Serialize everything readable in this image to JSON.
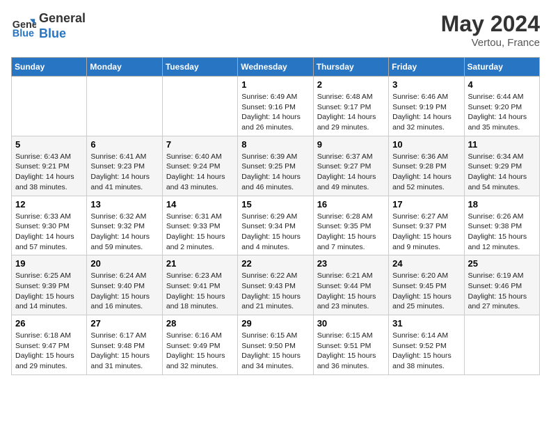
{
  "header": {
    "logo_line1": "General",
    "logo_line2": "Blue",
    "month_year": "May 2024",
    "location": "Vertou, France"
  },
  "weekdays": [
    "Sunday",
    "Monday",
    "Tuesday",
    "Wednesday",
    "Thursday",
    "Friday",
    "Saturday"
  ],
  "weeks": [
    [
      {
        "day": "",
        "info": ""
      },
      {
        "day": "",
        "info": ""
      },
      {
        "day": "",
        "info": ""
      },
      {
        "day": "1",
        "info": "Sunrise: 6:49 AM\nSunset: 9:16 PM\nDaylight: 14 hours and 26 minutes."
      },
      {
        "day": "2",
        "info": "Sunrise: 6:48 AM\nSunset: 9:17 PM\nDaylight: 14 hours and 29 minutes."
      },
      {
        "day": "3",
        "info": "Sunrise: 6:46 AM\nSunset: 9:19 PM\nDaylight: 14 hours and 32 minutes."
      },
      {
        "day": "4",
        "info": "Sunrise: 6:44 AM\nSunset: 9:20 PM\nDaylight: 14 hours and 35 minutes."
      }
    ],
    [
      {
        "day": "5",
        "info": "Sunrise: 6:43 AM\nSunset: 9:21 PM\nDaylight: 14 hours and 38 minutes."
      },
      {
        "day": "6",
        "info": "Sunrise: 6:41 AM\nSunset: 9:23 PM\nDaylight: 14 hours and 41 minutes."
      },
      {
        "day": "7",
        "info": "Sunrise: 6:40 AM\nSunset: 9:24 PM\nDaylight: 14 hours and 43 minutes."
      },
      {
        "day": "8",
        "info": "Sunrise: 6:39 AM\nSunset: 9:25 PM\nDaylight: 14 hours and 46 minutes."
      },
      {
        "day": "9",
        "info": "Sunrise: 6:37 AM\nSunset: 9:27 PM\nDaylight: 14 hours and 49 minutes."
      },
      {
        "day": "10",
        "info": "Sunrise: 6:36 AM\nSunset: 9:28 PM\nDaylight: 14 hours and 52 minutes."
      },
      {
        "day": "11",
        "info": "Sunrise: 6:34 AM\nSunset: 9:29 PM\nDaylight: 14 hours and 54 minutes."
      }
    ],
    [
      {
        "day": "12",
        "info": "Sunrise: 6:33 AM\nSunset: 9:30 PM\nDaylight: 14 hours and 57 minutes."
      },
      {
        "day": "13",
        "info": "Sunrise: 6:32 AM\nSunset: 9:32 PM\nDaylight: 14 hours and 59 minutes."
      },
      {
        "day": "14",
        "info": "Sunrise: 6:31 AM\nSunset: 9:33 PM\nDaylight: 15 hours and 2 minutes."
      },
      {
        "day": "15",
        "info": "Sunrise: 6:29 AM\nSunset: 9:34 PM\nDaylight: 15 hours and 4 minutes."
      },
      {
        "day": "16",
        "info": "Sunrise: 6:28 AM\nSunset: 9:35 PM\nDaylight: 15 hours and 7 minutes."
      },
      {
        "day": "17",
        "info": "Sunrise: 6:27 AM\nSunset: 9:37 PM\nDaylight: 15 hours and 9 minutes."
      },
      {
        "day": "18",
        "info": "Sunrise: 6:26 AM\nSunset: 9:38 PM\nDaylight: 15 hours and 12 minutes."
      }
    ],
    [
      {
        "day": "19",
        "info": "Sunrise: 6:25 AM\nSunset: 9:39 PM\nDaylight: 15 hours and 14 minutes."
      },
      {
        "day": "20",
        "info": "Sunrise: 6:24 AM\nSunset: 9:40 PM\nDaylight: 15 hours and 16 minutes."
      },
      {
        "day": "21",
        "info": "Sunrise: 6:23 AM\nSunset: 9:41 PM\nDaylight: 15 hours and 18 minutes."
      },
      {
        "day": "22",
        "info": "Sunrise: 6:22 AM\nSunset: 9:43 PM\nDaylight: 15 hours and 21 minutes."
      },
      {
        "day": "23",
        "info": "Sunrise: 6:21 AM\nSunset: 9:44 PM\nDaylight: 15 hours and 23 minutes."
      },
      {
        "day": "24",
        "info": "Sunrise: 6:20 AM\nSunset: 9:45 PM\nDaylight: 15 hours and 25 minutes."
      },
      {
        "day": "25",
        "info": "Sunrise: 6:19 AM\nSunset: 9:46 PM\nDaylight: 15 hours and 27 minutes."
      }
    ],
    [
      {
        "day": "26",
        "info": "Sunrise: 6:18 AM\nSunset: 9:47 PM\nDaylight: 15 hours and 29 minutes."
      },
      {
        "day": "27",
        "info": "Sunrise: 6:17 AM\nSunset: 9:48 PM\nDaylight: 15 hours and 31 minutes."
      },
      {
        "day": "28",
        "info": "Sunrise: 6:16 AM\nSunset: 9:49 PM\nDaylight: 15 hours and 32 minutes."
      },
      {
        "day": "29",
        "info": "Sunrise: 6:15 AM\nSunset: 9:50 PM\nDaylight: 15 hours and 34 minutes."
      },
      {
        "day": "30",
        "info": "Sunrise: 6:15 AM\nSunset: 9:51 PM\nDaylight: 15 hours and 36 minutes."
      },
      {
        "day": "31",
        "info": "Sunrise: 6:14 AM\nSunset: 9:52 PM\nDaylight: 15 hours and 38 minutes."
      },
      {
        "day": "",
        "info": ""
      }
    ]
  ]
}
